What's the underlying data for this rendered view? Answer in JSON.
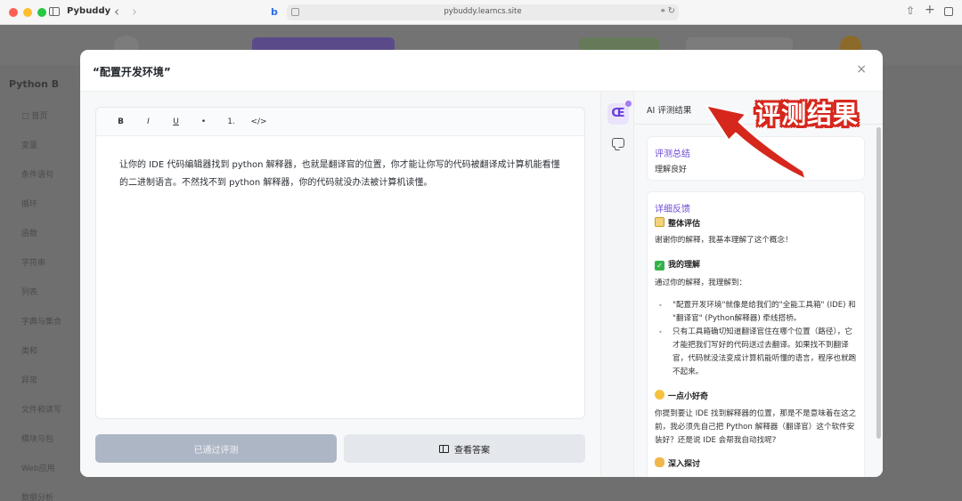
{
  "browser": {
    "app_name": "Pybuddy",
    "url": "pybuddy.learncs.site",
    "site_icon": "b"
  },
  "background_page": {
    "logo_text": "Python B",
    "sidebar": [
      "▢ 首页",
      "变量",
      "条件语句",
      "循环",
      "函数",
      "字符串",
      "列表",
      "字典与集合",
      "类和",
      "异常",
      "文件和读写",
      "模块与包",
      "Web应用",
      "数据分析"
    ]
  },
  "modal": {
    "title": "“配置开发环境”",
    "close_icon": "×",
    "editor": {
      "toolbar": [
        "B",
        "I",
        "U",
        "•",
        "1.",
        "</>"
      ],
      "content": "让你的 IDE 代码编辑器找到 python 解释器，也就是翻译官的位置，你才能让你写的代码被翻译成计算机能看懂的二进制语言。不然找不到 python 解释器，你的代码就没办法被计算机读懂。"
    },
    "buttons": {
      "passed": "已通过评测",
      "view_answer": "查看答案"
    },
    "rail": {
      "ai_label": "Œ"
    },
    "panel": {
      "title": "AI 评测结果",
      "summary_head": "评测总结",
      "summary_body": "理解良好",
      "feedback_head": "详细反馈",
      "sections": {
        "overall_title": "整体评估",
        "overall_text": "谢谢你的解释，我基本理解了这个概念！",
        "understanding_title": "我的理解",
        "understanding_intro": "通过你的解释，我理解到：",
        "bullet1": "\"配置开发环境\"就像是给我们的\"全能工具箱\" (IDE) 和 \"翻译官\" (Python解释器) 牵线搭桥。",
        "bullet2": "只有工具箱确切知道翻译官住在哪个位置（路径），它才能把我们写好的代码送过去翻译。如果找不到翻译官，代码就没法变成计算机能听懂的语言，程序也就跑不起来。",
        "curious_title": "一点小好奇",
        "curious_text": "你提到要让 IDE 找到解释器的位置，那是不是意味着在这之前，我必须先自己把 Python 解释器（翻译官）这个软件安装好？还是说 IDE 会帮我自动找呢?",
        "deep_title": "深入探讨"
      }
    }
  },
  "annotation": {
    "text": "评测结果",
    "color": "#d6271d"
  }
}
